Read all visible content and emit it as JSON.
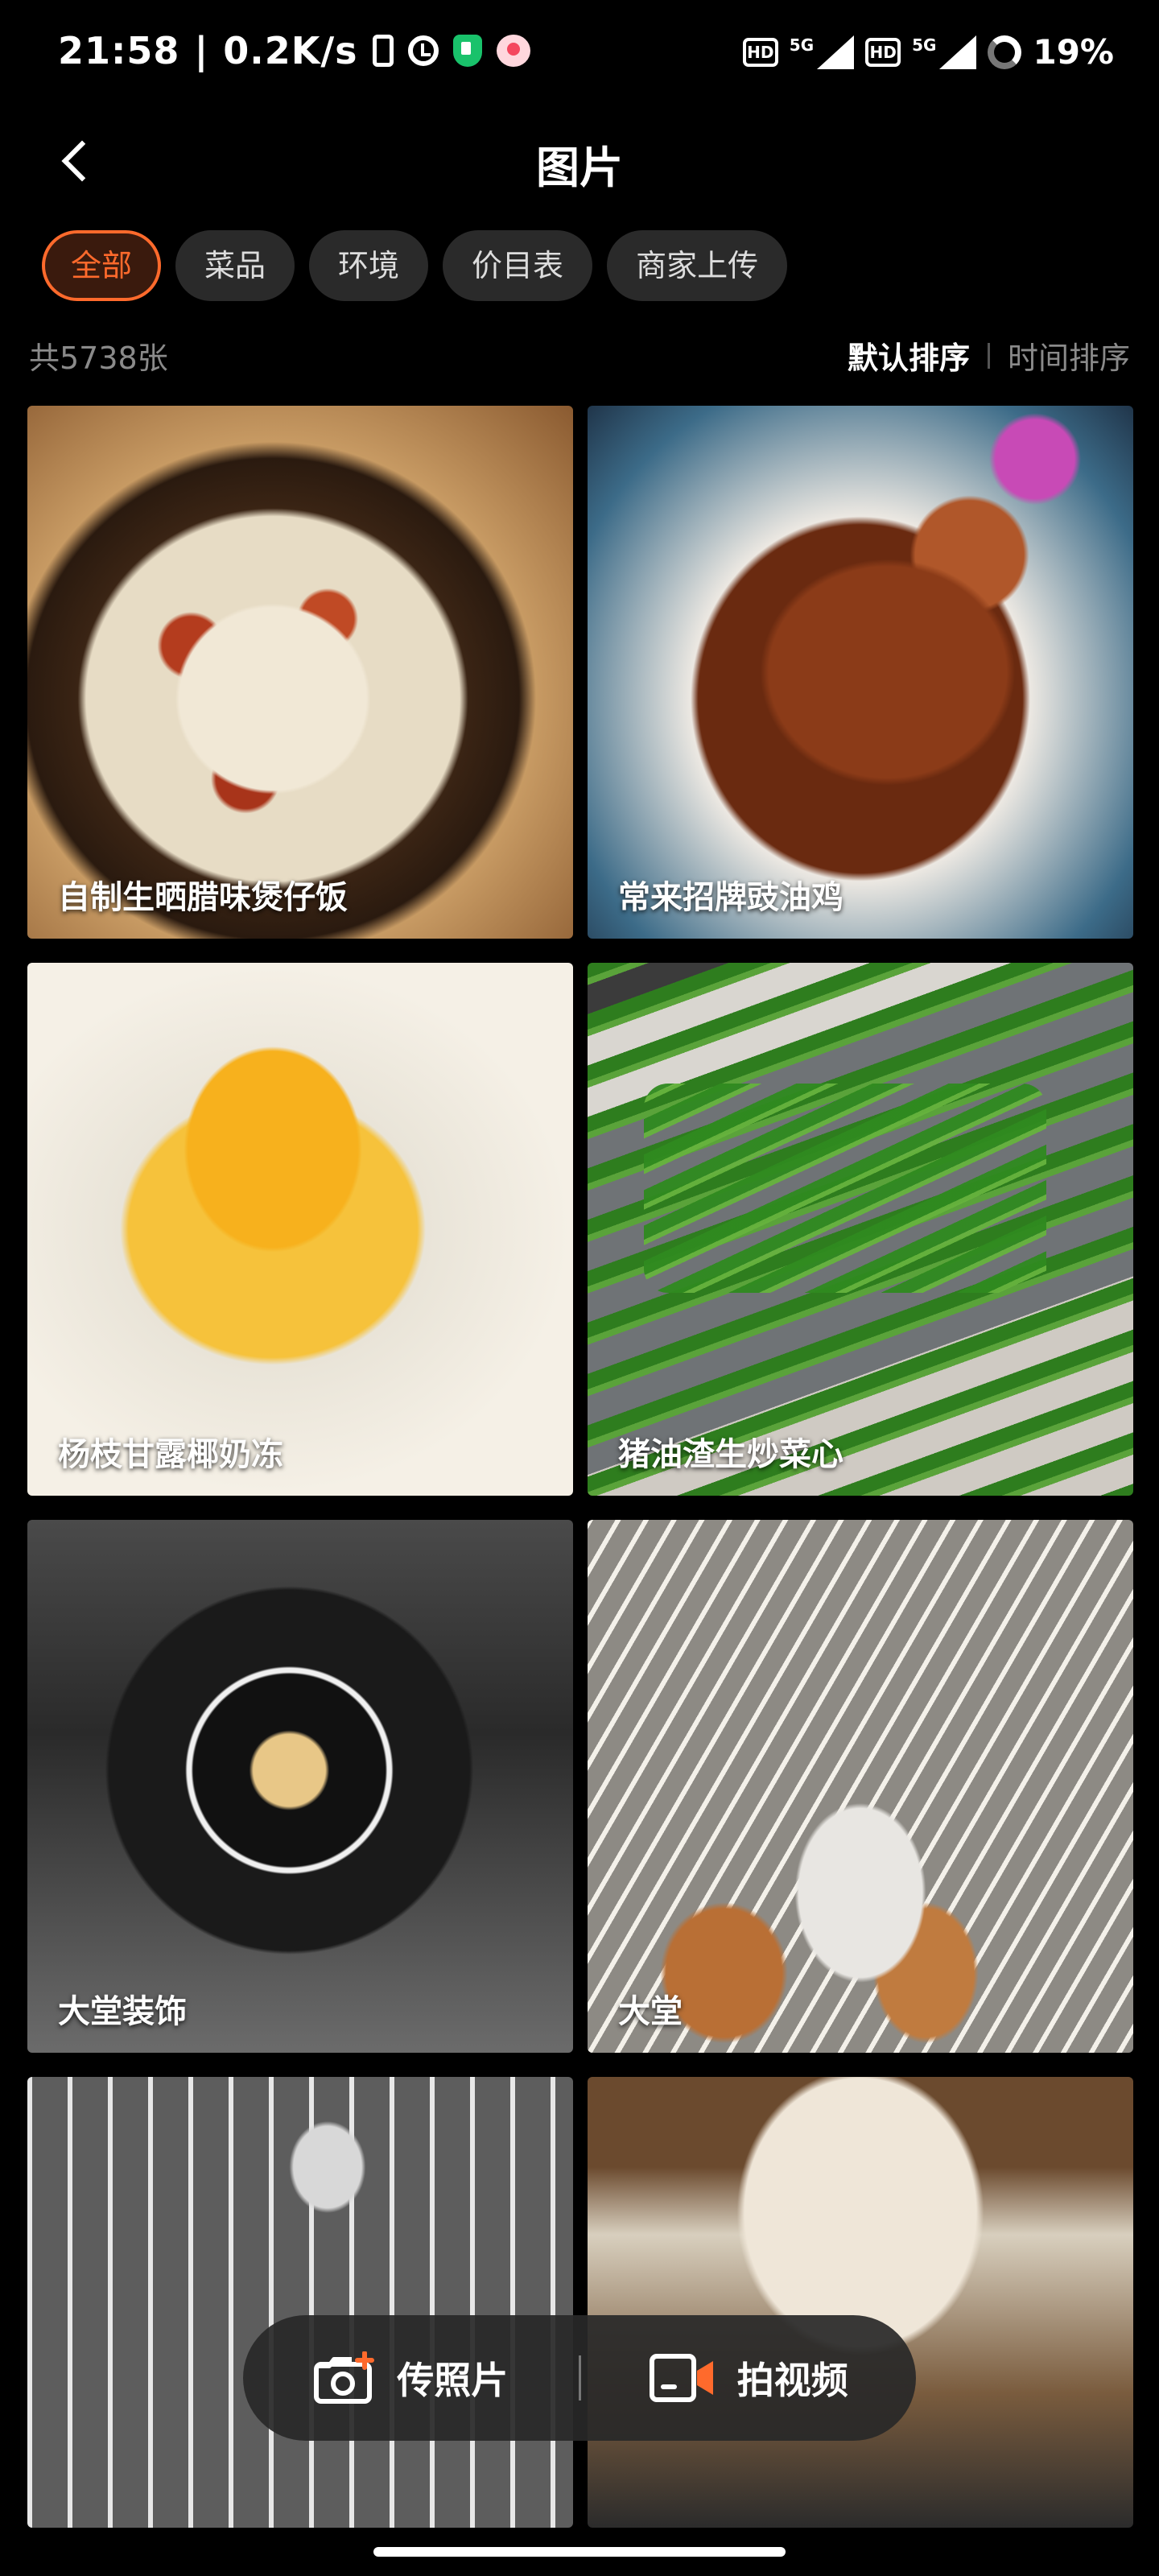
{
  "status_bar": {
    "time": "21:58",
    "net_speed": "0.2K/s",
    "hd1": "HD",
    "net1": "5G",
    "hd2": "HD",
    "net2": "5G",
    "battery": "19%"
  },
  "header": {
    "title": "图片"
  },
  "filters": [
    {
      "label": "全部",
      "active": true
    },
    {
      "label": "菜品",
      "active": false
    },
    {
      "label": "环境",
      "active": false
    },
    {
      "label": "价目表",
      "active": false
    },
    {
      "label": "商家上传",
      "active": false
    }
  ],
  "summary": {
    "count": "共5738张",
    "sort_default": "默认排序",
    "sort_time": "时间排序"
  },
  "photos": [
    {
      "caption": "自制生晒腊味煲仔饭"
    },
    {
      "caption": "常来招牌豉油鸡"
    },
    {
      "caption": "杨枝甘露椰奶冻"
    },
    {
      "caption": "猪油渣生炒菜心"
    },
    {
      "caption": "大堂装饰"
    },
    {
      "caption": "大堂"
    }
  ],
  "actions": {
    "upload_photo": "传照片",
    "record_video": "拍视频"
  },
  "colors": {
    "accent": "#ff6a2c",
    "background": "#000000"
  }
}
